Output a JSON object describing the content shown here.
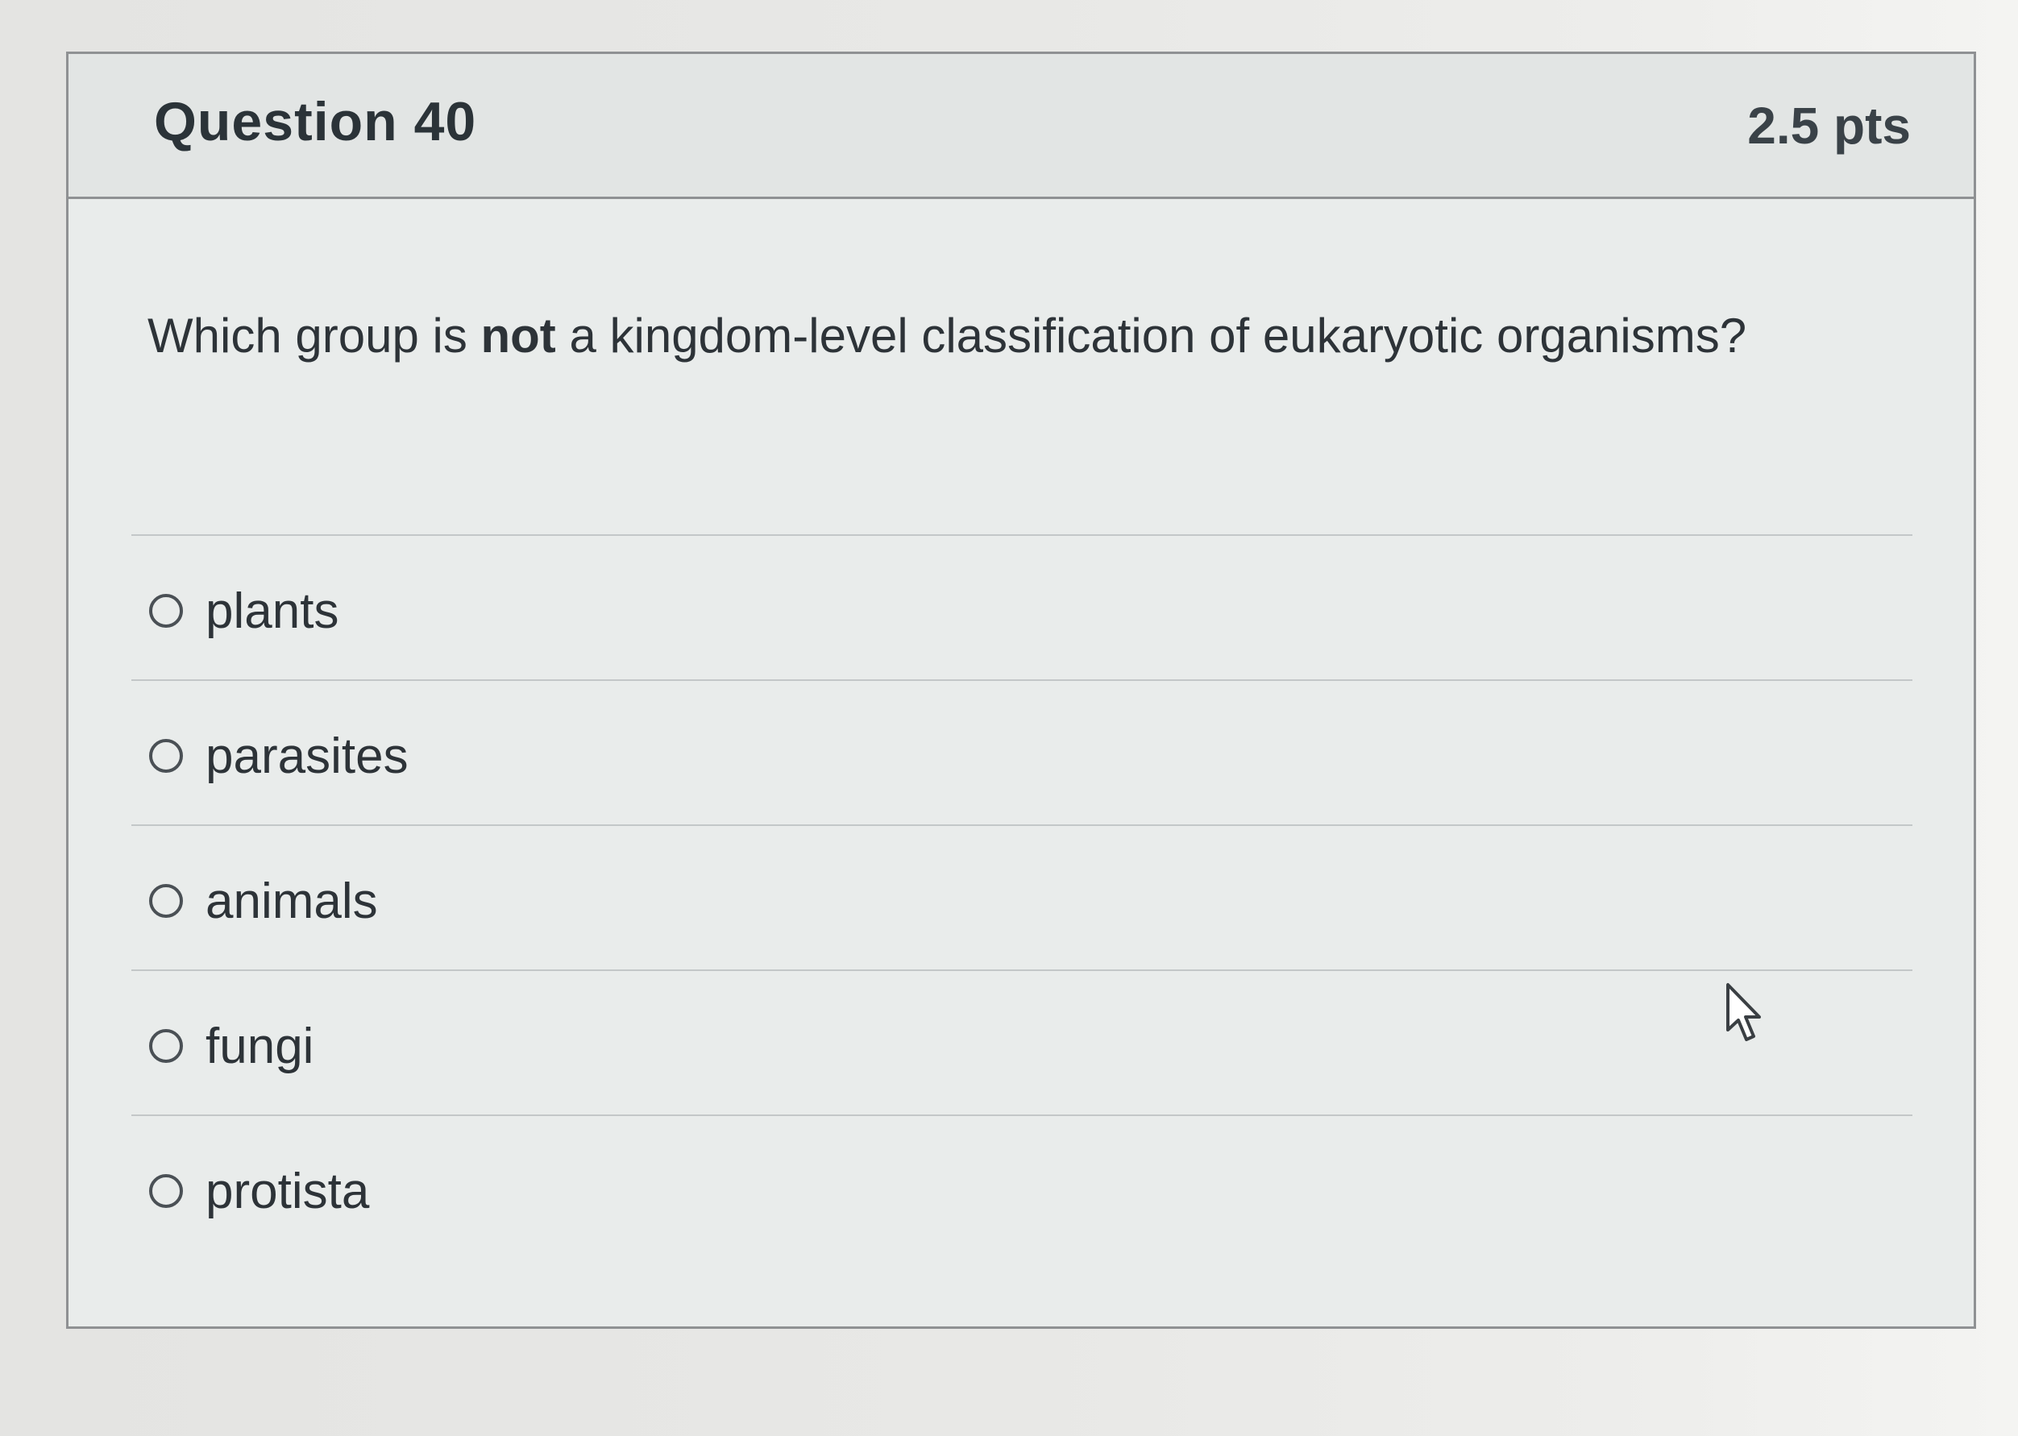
{
  "question": {
    "title": "Question 40",
    "points": "2.5 pts",
    "text_before": "Which group is ",
    "text_bold": "not",
    "text_after": " a kingdom-level classification of eukaryotic organisms?"
  },
  "answers": [
    {
      "label": "plants",
      "selected": false
    },
    {
      "label": "parasites",
      "selected": false
    },
    {
      "label": "animals",
      "selected": false
    },
    {
      "label": "fungi",
      "selected": false
    },
    {
      "label": "protista",
      "selected": false
    }
  ],
  "icons": {
    "radio": "radio-button-icon",
    "cursor": "mouse-pointer-icon"
  }
}
